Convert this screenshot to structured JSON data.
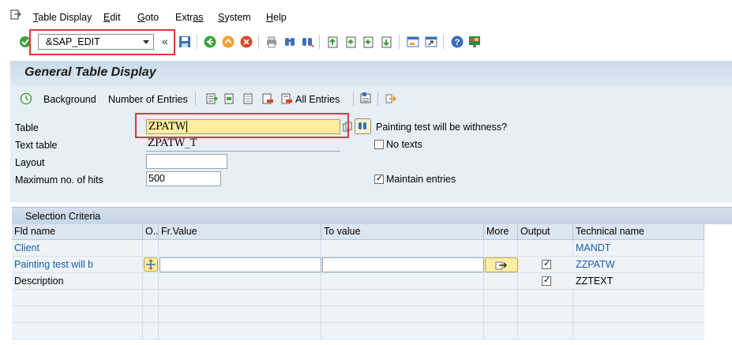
{
  "menu": {
    "items": [
      {
        "first": "T",
        "rest": "able Display"
      },
      {
        "first": "E",
        "rest": "dit"
      },
      {
        "first": "G",
        "rest": "oto"
      },
      {
        "first": "Extr",
        "rest": "as"
      },
      {
        "first": "S",
        "rest": "ystem"
      },
      {
        "first": "H",
        "rest": "elp"
      }
    ]
  },
  "toolbar": {
    "command_value": "&SAP_EDIT"
  },
  "title": "General Table Display",
  "app_toolbar": {
    "background_label": "Background",
    "entries_label": "Number of Entries",
    "all_entries_label": "All Entries"
  },
  "form": {
    "table_label": "Table",
    "table_value": "ZPATW",
    "table_desc": "Painting test will be withness?",
    "text_table_label": "Text table",
    "text_table_value": "ZPATW_T",
    "no_texts_label": "No texts",
    "layout_label": "Layout",
    "layout_value": "",
    "max_hits_label": "Maximum no. of hits",
    "max_hits_value": "500",
    "maintain_label": "Maintain entries"
  },
  "selection": {
    "title": "Selection Criteria",
    "headers": [
      "Fld name",
      "O..",
      "Fr.Value",
      "To value",
      "More",
      "Output",
      "Technical name"
    ],
    "rows": [
      {
        "name": "Client",
        "tech": "MANDT"
      },
      {
        "name": "Painting test will b",
        "tech": "ZZPATW"
      },
      {
        "name": "Description",
        "tech": "ZZTEXT"
      }
    ]
  },
  "colors": {
    "accent_red": "#e0363b",
    "highlight_yellow": "#fdeea0",
    "link_blue": "#1a5ea8"
  }
}
